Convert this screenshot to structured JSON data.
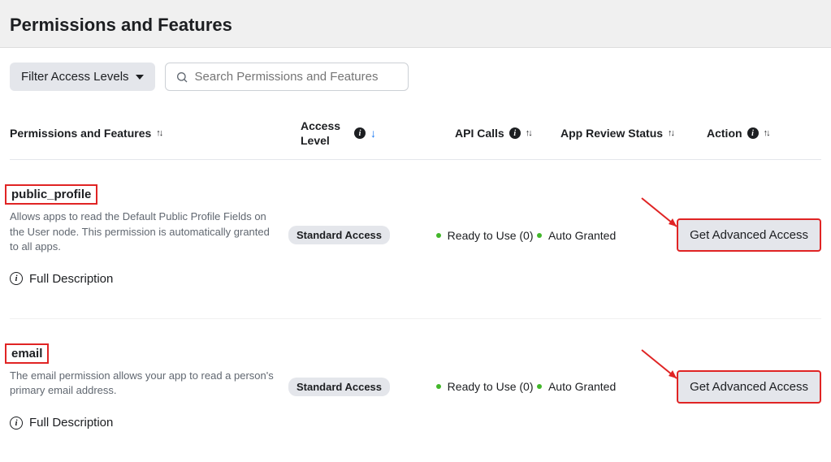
{
  "header": {
    "title": "Permissions and Features"
  },
  "controls": {
    "filter_label": "Filter Access Levels",
    "search_placeholder": "Search Permissions and Features"
  },
  "columns": {
    "perm": "Permissions and Features",
    "access": "Access Level",
    "api": "API Calls",
    "review": "App Review Status",
    "action": "Action"
  },
  "rows": [
    {
      "name": "public_profile",
      "desc": "Allows apps to read the Default Public Profile Fields on the User node. This permission is automatically granted to all apps.",
      "full_desc_label": "Full Description",
      "access_badge": "Standard Access",
      "api_status": "Ready to Use (0)",
      "review_status": "Auto Granted",
      "action_label": "Get Advanced Access"
    },
    {
      "name": "email",
      "desc": "The email permission allows your app to read a person's primary email address.",
      "full_desc_label": "Full Description",
      "access_badge": "Standard Access",
      "api_status": "Ready to Use (0)",
      "review_status": "Auto Granted",
      "action_label": "Get Advanced Access"
    }
  ]
}
